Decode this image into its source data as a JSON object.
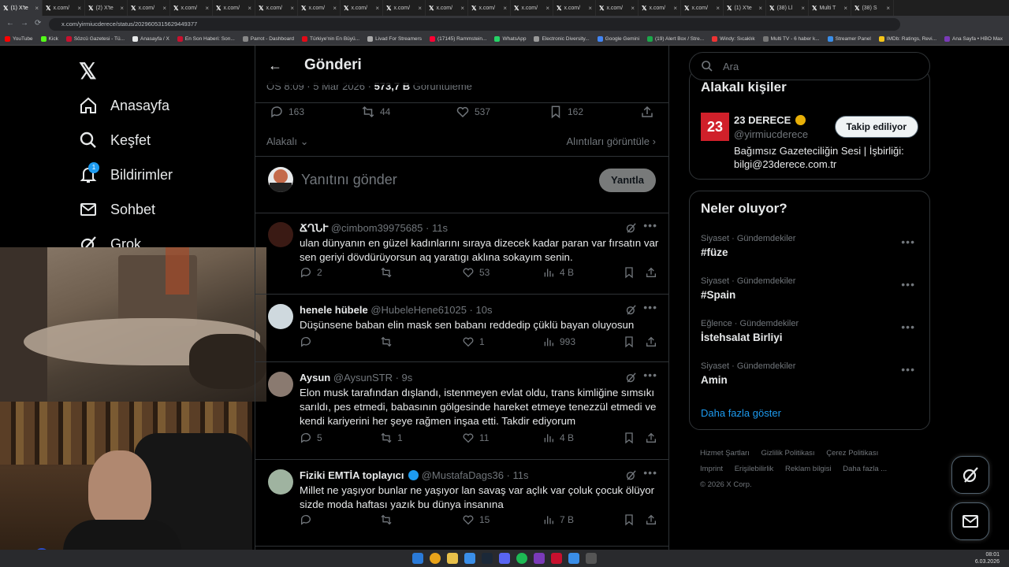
{
  "browser": {
    "tabs": [
      "(1) X'te",
      "x.com/",
      "(2) X'te",
      "x.com/",
      "x.com/",
      "x.com/",
      "x.com/",
      "x.com/",
      "x.com/",
      "x.com/",
      "x.com/",
      "x.com/",
      "x.com/",
      "x.com/",
      "x.com/",
      "x.com/",
      "x.com/",
      "(1) X'te",
      "(38) Ll",
      "Multi T",
      "(38) S"
    ],
    "url": "x.com/yirmiucderece/status/2029605315629449377",
    "bookmarks": [
      "YouTube",
      "Kick",
      "Sözcü Gazetesi - Tü...",
      "Anasayfa / X",
      "En Son Haberi: Son...",
      "Parrot - Dashboard",
      "Türkiye'nin En Büyü...",
      "Livad For Streamers",
      "(17145) Rammstein...",
      "WhatsApp",
      "Electronic Diversity...",
      "Google Gemini",
      "(19) Alert Box / Stre...",
      "Windy: Sıcaklık",
      "Multi TV - 6 haber k...",
      "Streamer Panel",
      "IMDb: Ratings, Revi...",
      "Ana Sayfa • HBO Max",
      "Tüm Yer İşaretleri"
    ]
  },
  "nav": {
    "logo": "𝕏",
    "items": [
      {
        "label": "Anasayfa",
        "icon": "home-icon"
      },
      {
        "label": "Keşfet",
        "icon": "search-icon"
      },
      {
        "label": "Bildirimler",
        "icon": "bell-icon",
        "badge": "1"
      },
      {
        "label": "Sohbet",
        "icon": "mail-icon"
      },
      {
        "label": "Grok",
        "icon": "grok-icon"
      }
    ]
  },
  "post": {
    "header_title": "Gönderi",
    "meta_time": "ÖS 8:09 · 5 Mar 2026 · ",
    "meta_views": "573,7 B",
    "meta_views_label": " Görüntüleme",
    "replies": "163",
    "reposts": "44",
    "likes": "537",
    "bookmarks": "162",
    "relevant_label": "Alakalı",
    "quotes_label": "Alıntıları görüntüle",
    "reply_placeholder": "Yanıtını gönder",
    "reply_button": "Yanıtla"
  },
  "replies": [
    {
      "name": "ՃՂՆՒ",
      "handle": "@cimbom39975685 · 11s",
      "text": "ulan dünyanın en güzel kadınlarını sıraya dizecek kadar paran var fırsatın var sen geriyi dövdürüyorsun aq yaratıgı aklına sokayım senin.",
      "replies": "2",
      "reposts": "",
      "likes": "53",
      "views": "4 B",
      "verified": false
    },
    {
      "name": "henele hübele",
      "handle": "@HubeleHene61025 · 10s",
      "text": "Düşünsene baban elin mask sen babanı reddedip çüklü bayan oluyosun",
      "replies": "",
      "reposts": "",
      "likes": "1",
      "views": "993",
      "verified": false
    },
    {
      "name": "Aysun",
      "handle": "@AysunSTR · 9s",
      "text": "Elon musk tarafından dışlandı, istenmeyen evlat oldu, trans kimliğine sımsıkı sarıldı, pes etmedi, babasının gölgesinde hareket etmeye tenezzül etmedi ve kendi kariyerini her şeye rağmen inşaa etti. Takdir ediyorum",
      "replies": "5",
      "reposts": "1",
      "likes": "11",
      "views": "4 B",
      "verified": false
    },
    {
      "name": "Fiziki EMTİA toplayıcı",
      "handle": "@MustafaDags36 · 11s",
      "text": "Millet ne yaşıyor bunlar ne yaşıyor lan savaş var açlık var çoluk çocuk ölüyor sizde moda haftası yazık bu dünya insanına",
      "replies": "",
      "reposts": "",
      "likes": "15",
      "views": "7 B",
      "verified": true
    }
  ],
  "right": {
    "search_placeholder": "Ara",
    "related_title": "Alakalı kişiler",
    "related": {
      "name": "23 DERECE",
      "handle": "@yirmiucderece",
      "bio": "Bağımsız Gazeteciliğin Sesi | İşbirliği: bilgi@23derece.com.tr",
      "follow_label": "Takip ediliyor",
      "avatar_text": "23"
    },
    "trends_title": "Neler oluyor?",
    "trends": [
      {
        "category": "Siyaset · Gündemdekiler",
        "name": "#füze"
      },
      {
        "category": "Siyaset · Gündemdekiler",
        "name": "#Spain"
      },
      {
        "category": "Eğlence · Gündemdekiler",
        "name": "İstehsalat Birliyi"
      },
      {
        "category": "Siyaset · Gündemdekiler",
        "name": "Amin"
      }
    ],
    "show_more": "Daha fazla göster",
    "footer": [
      "Hizmet Şartları",
      "Gizlilik Politikası",
      "Çerez Politikası",
      "Imprint",
      "Erişilebilirlik",
      "Reklam bilgisi",
      "Daha fazla ...",
      "© 2026 X Corp."
    ]
  },
  "clock": {
    "time": "08:01",
    "date": "6.03.2026"
  },
  "colors": {
    "accent": "#1d9bf0",
    "bg": "#000000",
    "border": "#2f3336",
    "muted": "#71767b"
  }
}
